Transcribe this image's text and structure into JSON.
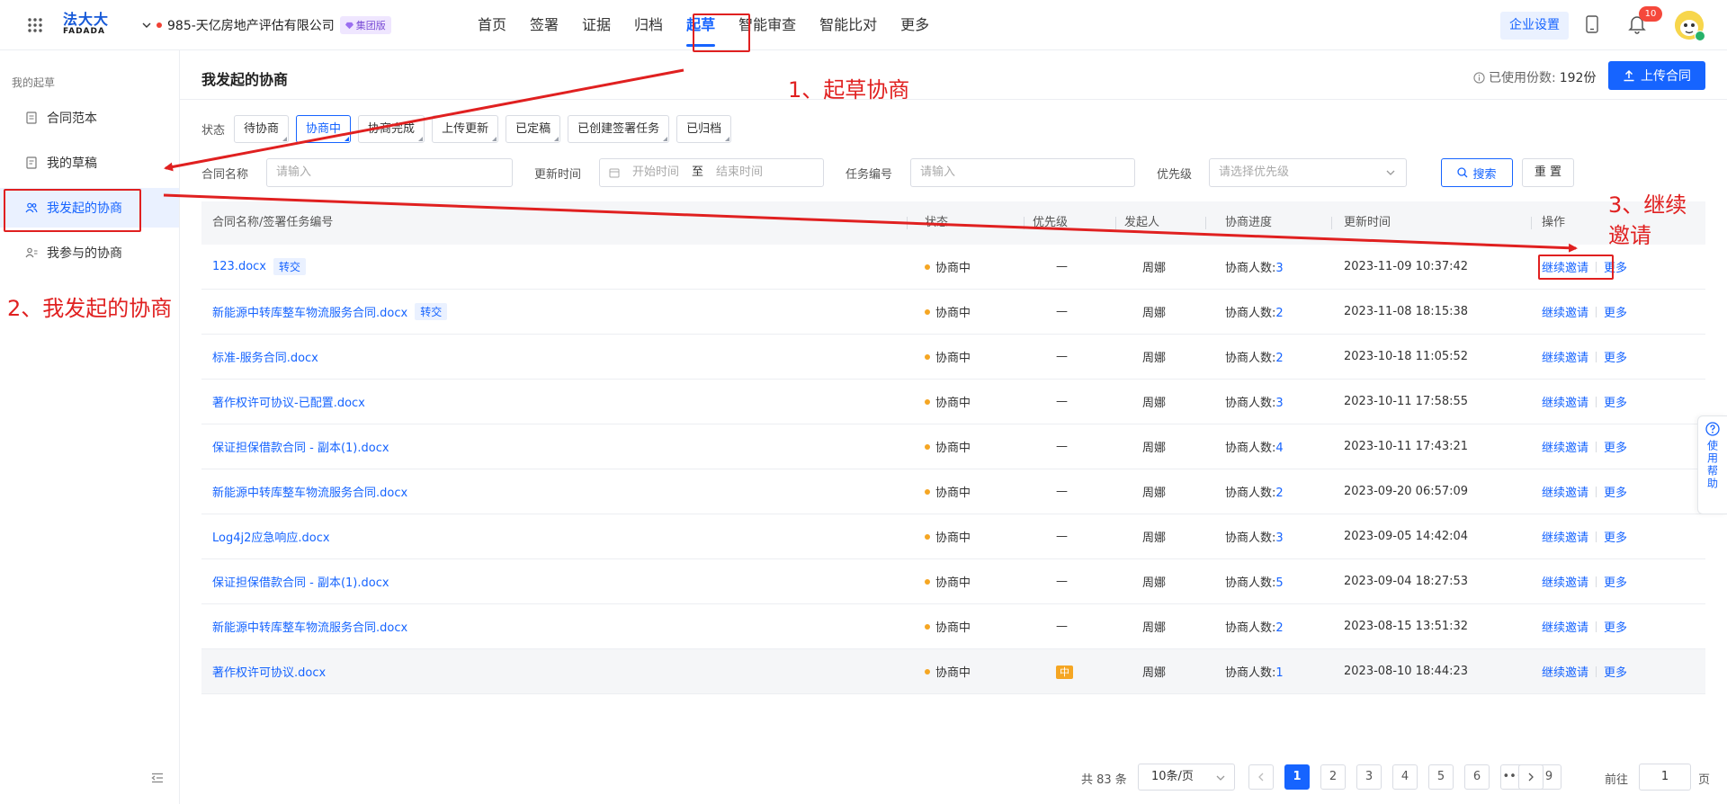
{
  "topbar": {
    "logo_cn": "法大大",
    "logo_en": "FADADA",
    "company": "985-天亿房地产评估有限公司",
    "group_badge": "集团版",
    "nav": [
      "首页",
      "签署",
      "证据",
      "归档",
      "起草",
      "智能审查",
      "智能比对",
      "更多"
    ],
    "enterprise_settings": "企业设置",
    "notification_count": "10"
  },
  "sidebar": {
    "group_title": "我的起草",
    "items": [
      {
        "label": "合同范本"
      },
      {
        "label": "我的草稿"
      },
      {
        "label": "我发起的协商"
      },
      {
        "label": "我参与的协商"
      }
    ]
  },
  "main": {
    "title": "我发起的协商",
    "used_label": "已使用份数:",
    "used_value": "192份",
    "upload_label": "上传合同",
    "status_label": "状态",
    "status_chips": [
      "待协商",
      "协商中",
      "协商完成",
      "上传更新",
      "已定稿",
      "已创建签署任务",
      "已归档"
    ],
    "filters": {
      "name_label": "合同名称",
      "name_placeholder": "请输入",
      "time_label": "更新时间",
      "start_placeholder": "开始时间",
      "to": "至",
      "end_placeholder": "结束时间",
      "task_label": "任务编号",
      "task_placeholder": "请输入",
      "prio_label": "优先级",
      "prio_placeholder": "请选择优先级",
      "search": "搜索",
      "reset": "重 置"
    },
    "table": {
      "headers": [
        "合同名称/签署任务编号",
        "状态",
        "优先级",
        "发起人",
        "协商进度",
        "更新时间",
        "操作"
      ],
      "progress_label": "协商人数:",
      "action_continue": "继续邀请",
      "action_more": "更多",
      "rows": [
        {
          "name": "123.docx",
          "tag": "转交",
          "status": "协商中",
          "priority": "—",
          "initiator": "周娜",
          "count": "3",
          "time": "2023-11-09 10:37:42"
        },
        {
          "name": "新能源中转库整车物流服务合同.docx",
          "tag": "转交",
          "status": "协商中",
          "priority": "—",
          "initiator": "周娜",
          "count": "2",
          "time": "2023-11-08 18:15:38"
        },
        {
          "name": "标准-服务合同.docx",
          "tag": "",
          "status": "协商中",
          "priority": "—",
          "initiator": "周娜",
          "count": "2",
          "time": "2023-10-18 11:05:52"
        },
        {
          "name": "著作权许可协议-已配置.docx",
          "tag": "",
          "status": "协商中",
          "priority": "—",
          "initiator": "周娜",
          "count": "3",
          "time": "2023-10-11 17:58:55"
        },
        {
          "name": "保证担保借款合同 - 副本(1).docx",
          "tag": "",
          "status": "协商中",
          "priority": "—",
          "initiator": "周娜",
          "count": "4",
          "time": "2023-10-11 17:43:21"
        },
        {
          "name": "新能源中转库整车物流服务合同.docx",
          "tag": "",
          "status": "协商中",
          "priority": "—",
          "initiator": "周娜",
          "count": "2",
          "time": "2023-09-20 06:57:09"
        },
        {
          "name": "Log4j2应急响应.docx",
          "tag": "",
          "status": "协商中",
          "priority": "—",
          "initiator": "周娜",
          "count": "3",
          "time": "2023-09-05 14:42:04"
        },
        {
          "name": "保证担保借款合同 - 副本(1).docx",
          "tag": "",
          "status": "协商中",
          "priority": "—",
          "initiator": "周娜",
          "count": "5",
          "time": "2023-09-04 18:27:53"
        },
        {
          "name": "新能源中转库整车物流服务合同.docx",
          "tag": "",
          "status": "协商中",
          "priority": "—",
          "initiator": "周娜",
          "count": "2",
          "time": "2023-08-15 13:51:32"
        },
        {
          "name": "著作权许可协议.docx",
          "tag": "",
          "status": "协商中",
          "priority": "中",
          "initiator": "周娜",
          "count": "1",
          "time": "2023-08-10 18:44:23"
        }
      ]
    },
    "pagination": {
      "total": "共 83 条",
      "page_size": "10条/页",
      "pages": [
        "1",
        "2",
        "3",
        "4",
        "5",
        "6",
        "•••",
        "9"
      ],
      "current": "1",
      "goto_label": "前往",
      "goto_value": "1",
      "goto_unit": "页"
    }
  },
  "help": {
    "label": "使用帮助"
  },
  "annotations": {
    "step1": "1、起草协商",
    "step2": "2、我发起的协商",
    "step3_line1": "3、继续",
    "step3_line2": "邀请"
  },
  "colors": {
    "accent": "#1664ff",
    "annotation": "#e02020",
    "status_dot": "#f5a623"
  }
}
